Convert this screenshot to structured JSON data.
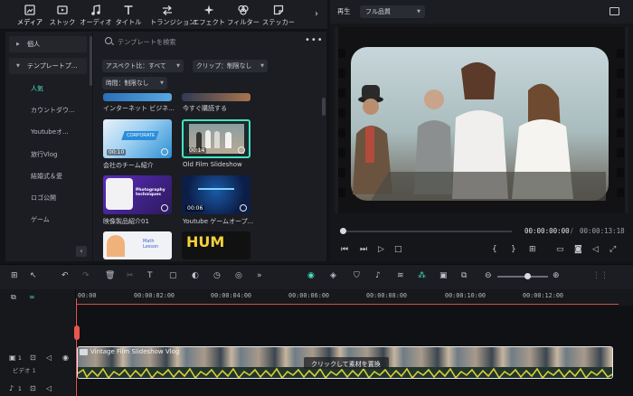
{
  "toolbar": {
    "items": [
      {
        "label": "メディア",
        "icon": "media-icon"
      },
      {
        "label": "ストック",
        "icon": "stock-icon"
      },
      {
        "label": "オーディオ",
        "icon": "music-note-icon"
      },
      {
        "label": "タイトル",
        "icon": "title-t-icon"
      },
      {
        "label": "トランジション",
        "icon": "transition-icon"
      },
      {
        "label": "エフェクト",
        "icon": "sparkle-icon"
      },
      {
        "label": "フィルター",
        "icon": "filter-icon"
      },
      {
        "label": "ステッカー",
        "icon": "sticker-icon"
      }
    ],
    "more": "›"
  },
  "nav": {
    "sections": [
      {
        "label": "個人"
      },
      {
        "label": "テンプレートプ..."
      }
    ],
    "items": [
      {
        "label": "人気",
        "active": true
      },
      {
        "label": "カウントダウ..."
      },
      {
        "label": "Youtubeオ..."
      },
      {
        "label": "旅行Vlog"
      },
      {
        "label": "結婚式＆愛"
      },
      {
        "label": "ロゴ公開"
      },
      {
        "label": "ゲーム"
      }
    ],
    "collapse": "‹"
  },
  "search": {
    "placeholder": "テンプレートを検索",
    "more": "•••"
  },
  "filters": [
    {
      "label": "アスペクト比：すべて"
    },
    {
      "label": "クリップ：制限なし"
    },
    {
      "label": "時間：制限なし"
    }
  ],
  "templates": [
    {
      "title": "インターネット ビジネ..."
    },
    {
      "title": "今すぐ購読する"
    },
    {
      "title": "会社のチーム紹介",
      "duration": "00:10"
    },
    {
      "title": "Old Film Slideshow",
      "duration": "00:14",
      "selected": true
    },
    {
      "title": "映像製品紹介01",
      "duration": "",
      "badge": "Photography techniques"
    },
    {
      "title": "Youtube ゲームオープ...",
      "duration": "00:06"
    },
    {
      "title": "",
      "badge": "Math Lesson"
    },
    {
      "title": "",
      "badge": "HUM"
    }
  ],
  "thumb_text": {
    "corporate": "CORPORATE"
  },
  "preview": {
    "play_label": "再生",
    "quality": "フル品質",
    "timecode": "00:00:00:00",
    "timecode_sep": "/",
    "timecode_total": "00:00:13:18",
    "progress": 0.0
  },
  "timeline": {
    "ticks": [
      "00:00",
      "00:00:02:00",
      "00:00:04:00",
      "00:00:06:00",
      "00:00:08:00",
      "00:00:10:00",
      "00:00:12:00"
    ],
    "clip_title": "Vintage Film Slideshow Vlog",
    "clip_hint": "クリックして素材を置換",
    "track_label": "ビデオ 1",
    "track_number": "1"
  },
  "colors": {
    "accent": "#46e2c3",
    "playhead": "#e8574f",
    "clip_border": "#e7e9ed"
  }
}
